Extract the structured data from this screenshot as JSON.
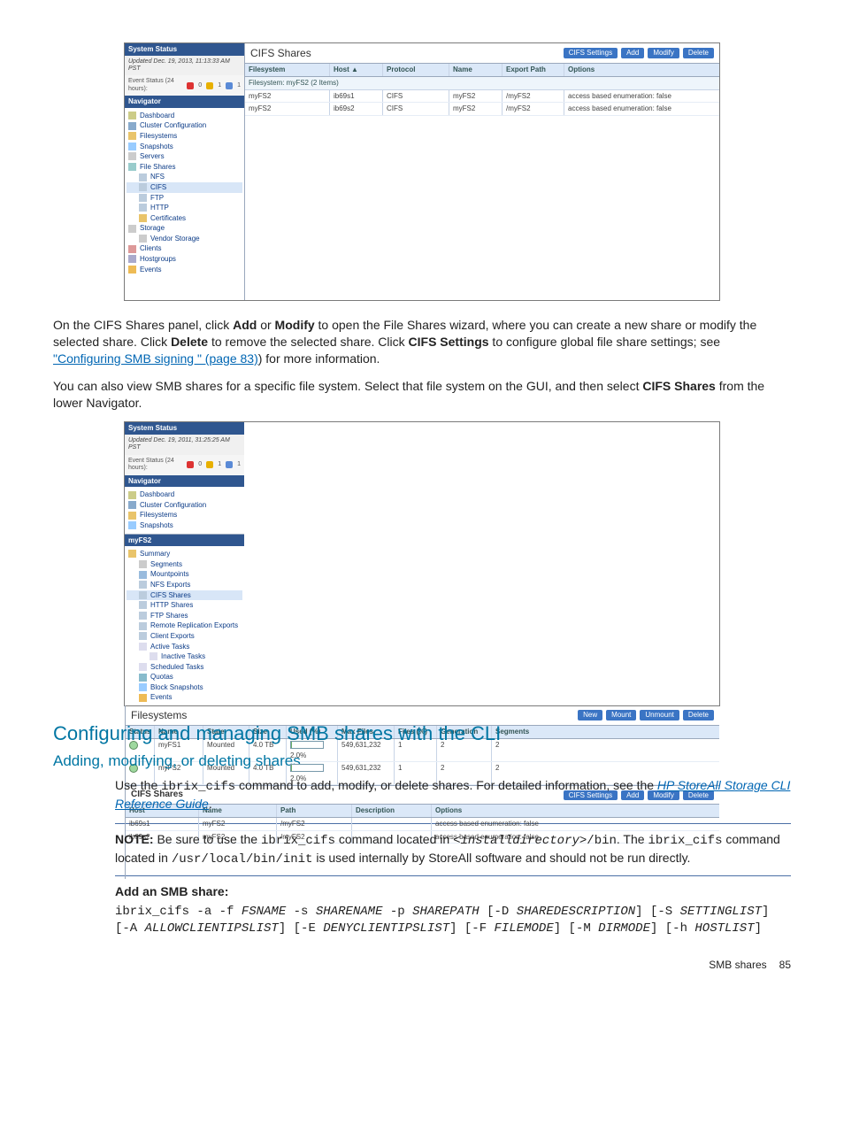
{
  "colors": {
    "accent": "#2f568f",
    "link": "#0066b3"
  },
  "s1": {
    "status_title": "System Status",
    "updated": "Updated Dec. 19, 2013, 11:13:33 AM PST",
    "event_status": "Event Status (24 hours):",
    "event_counts": [
      "0",
      "1",
      "1"
    ],
    "nav_title": "Navigator",
    "tree": [
      "Dashboard",
      "Cluster Configuration",
      "Filesystems",
      "Snapshots",
      "Servers",
      "File Shares",
      "NFS",
      "CIFS",
      "FTP",
      "HTTP",
      "Certificates",
      "Storage",
      "Vendor Storage",
      "Clients",
      "Hostgroups",
      "Events"
    ],
    "panel_title": "CIFS Shares",
    "buttons": [
      "CIFS Settings",
      "Add",
      "Modify",
      "Delete"
    ],
    "headers": [
      "Filesystem",
      "Host ▲",
      "Protocol",
      "Name",
      "Export Path",
      "Options"
    ],
    "group": "Filesystem: myFS2 (2 Items)",
    "rows": [
      [
        "myFS2",
        "ib69s1",
        "CIFS",
        "myFS2",
        "/myFS2",
        "access based enumeration: false"
      ],
      [
        "myFS2",
        "ib69s2",
        "CIFS",
        "myFS2",
        "/myFS2",
        "access based enumeration: false"
      ]
    ]
  },
  "p1a": "On the CIFS Shares panel, click ",
  "p1b": " or ",
  "p1c": " to open the File Shares wizard, where you can create a new share or modify the selected share. Click ",
  "p1d": " to remove the selected share. Click ",
  "p1e": " to configure global file share settings; see ",
  "p1_link": "\"Configuring SMB signing \" (page 83)",
  "p1f": ") for more information.",
  "add": "Add",
  "modify": "Modify",
  "delete": "Delete",
  "cifsset": "CIFS Settings",
  "p2a": "You can also view SMB shares for a specific file system. Select that file system on the GUI, and then select ",
  "p2b": " from the lower Navigator.",
  "cifssh": "CIFS Shares",
  "s2": {
    "status_title": "System Status",
    "updated": "Updated Dec. 19, 2011, 31:25:25 AM PST",
    "event_status": "Event Status (24 hours):",
    "event_counts": [
      "0",
      "1",
      "1"
    ],
    "nav_title": "Navigator",
    "tree_top": [
      "Dashboard",
      "Cluster Configuration",
      "Filesystems",
      "Snapshots"
    ],
    "fs_title": "myFS2",
    "tree_bot": [
      "Summary",
      "Segments",
      "Mountpoints",
      "NFS Exports",
      "CIFS Shares",
      "HTTP Shares",
      "FTP Shares",
      "Remote Replication Exports",
      "Client Exports",
      "Active Tasks",
      "Inactive Tasks",
      "Scheduled Tasks",
      "Quotas",
      "Block Snapshots",
      "Events"
    ],
    "top_panel_title": "Filesystems",
    "top_buttons": [
      "New",
      "Mount",
      "Unmount",
      "Delete"
    ],
    "top_headers": [
      "Status",
      "Name",
      "State",
      "Size",
      "Used (%)",
      "Max Files",
      "Files (%)",
      "Generation",
      "Segments"
    ],
    "top_rows": [
      [
        "●",
        "myFS1",
        "Mounted",
        "4.0 TB",
        "2.0%",
        "549,631,232",
        "1",
        "2",
        "2"
      ],
      [
        "●",
        "myFS2",
        "Mounted",
        "4.0 TB",
        "2.0%",
        "549,631,232",
        "1",
        "2",
        "2"
      ]
    ],
    "bot_panel_title": "CIFS Shares",
    "bot_buttons": [
      "CIFS Settings",
      "Add",
      "Modify",
      "Delete"
    ],
    "bot_headers": [
      "Host",
      "Name",
      "Path",
      "Description",
      "Options"
    ],
    "bot_rows": [
      [
        "ib69s1",
        "myFS2",
        "/myFS2",
        "",
        "access based enumeration: false"
      ],
      [
        "ib69s2",
        "myFS2",
        "/myFS2",
        "",
        "access based enumeration: false"
      ]
    ]
  },
  "h2": "Configuring and managing SMB shares with the CLI",
  "h3": "Adding, modifying, or deleting shares",
  "p3a": "Use the ",
  "p3cmd": "ibrix_cifs",
  "p3b": " command to add, modify, or delete shares. For detailed information, see the ",
  "p3link": "HP StoreAll Storage CLI Reference Guide",
  "p3c": ".",
  "note_label": "NOTE:",
  "note_a": "   Be sure to use the ",
  "note_b": " command located in ",
  "note_path1": "<installdirectory>",
  "note_path1b": "/bin",
  "note_c": ". The ",
  "note_d": " command located in ",
  "note_path2": "/usr/local/bin/init",
  "note_e": " is used internally by StoreAll software and should not be run directly.",
  "h4": "Add an SMB share:",
  "cmd": "ibrix_cifs -a -f FSNAME -s SHARENAME -p SHAREPATH [-D SHAREDESCRIPTION] [-S SETTINGLIST] [-A ALLOWCLIENTIPSLIST] [-E DENYCLIENTIPSLIST] [-F FILEMODE] [-M DIRMODE] [-h HOSTLIST]",
  "footer_text": "SMB shares",
  "footer_page": "85"
}
